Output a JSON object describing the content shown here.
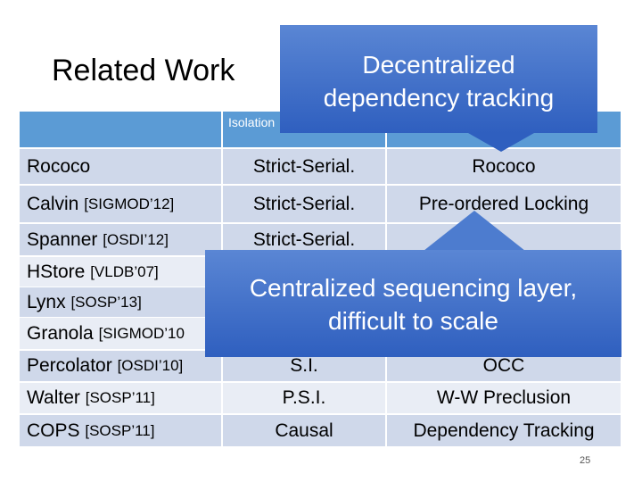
{
  "slide": {
    "title": "Related Work",
    "page_number": "25"
  },
  "table": {
    "header": [
      "",
      "Isolation",
      ""
    ],
    "rows": [
      {
        "name": "Rococo",
        "ref": "",
        "isolation": "Strict-Serial.",
        "approach": "Rococo"
      },
      {
        "name": "Calvin",
        "ref": "[SIGMOD’12]",
        "isolation": "Strict-Serial.",
        "approach": "Pre-ordered Locking"
      },
      {
        "name": "Spanner",
        "ref": "[OSDI’12]",
        "isolation": "Strict-Serial.",
        "approach": ""
      },
      {
        "name": "HStore",
        "ref": "[VLDB’07]",
        "isolation": "",
        "approach": ""
      },
      {
        "name": "Lynx",
        "ref": "[SOSP’13]",
        "isolation": "",
        "approach": ""
      },
      {
        "name": "Granola",
        "ref": "[SIGMOD’10",
        "isolation": "",
        "approach": ""
      },
      {
        "name": "Percolator",
        "ref": "[OSDI’10]",
        "isolation": "S.I.",
        "approach": "OCC"
      },
      {
        "name": "Walter",
        "ref": "[SOSP’11]",
        "isolation": "P.S.I.",
        "approach": "W-W Preclusion"
      },
      {
        "name": "COPS",
        "ref": "[SOSP’11]",
        "isolation": "Causal",
        "approach": "Dependency Tracking"
      }
    ]
  },
  "callouts": {
    "top": {
      "line1": "Decentralized",
      "line2": "dependency tracking"
    },
    "bottom": {
      "line1": "Centralized sequencing layer,",
      "line2": "difficult to scale"
    }
  },
  "colors": {
    "header": "#5b9bd5",
    "row_dark": "#cfd8ea",
    "row_light": "#e9edf5",
    "callout": "#3e6fc8"
  }
}
